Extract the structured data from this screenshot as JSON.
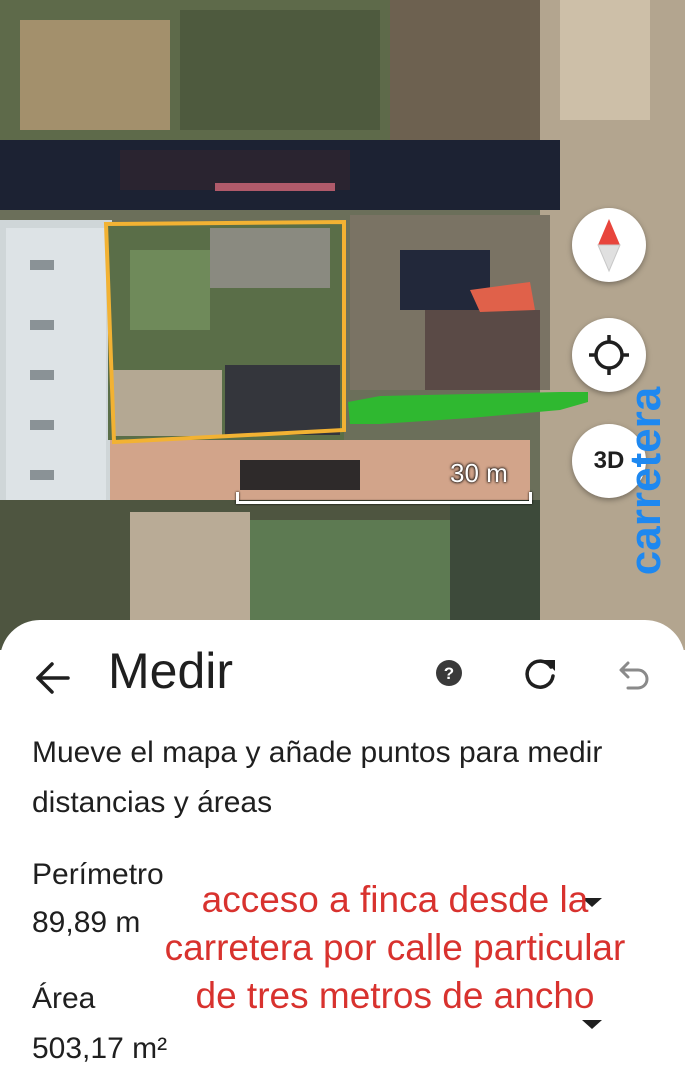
{
  "map": {
    "scale_label": "30 m",
    "annotation_road": "carretera",
    "controls": {
      "compass_icon": "compass-icon",
      "locate_icon": "my-location-icon",
      "view3d_label": "3D"
    },
    "colors": {
      "measure_outline": "#f2b233",
      "access_path": "#2fb830",
      "annotation_text": "#1e88f0"
    }
  },
  "sheet": {
    "title": "Medir",
    "back_icon": "arrow-back-icon",
    "help_icon": "help-icon",
    "reset_icon": "refresh-icon",
    "undo_icon": "undo-icon",
    "instructions": "Mueve el mapa y añade puntos para medir distancias y áreas",
    "perimeter_label": "Perímetro",
    "perimeter_value": "89,89 m",
    "area_label": "Área",
    "area_value": "503,17 m²",
    "note": "acceso a finca desde la carretera  por calle particular de tres metros de ancho",
    "colors": {
      "note_text": "#d8322e"
    }
  }
}
